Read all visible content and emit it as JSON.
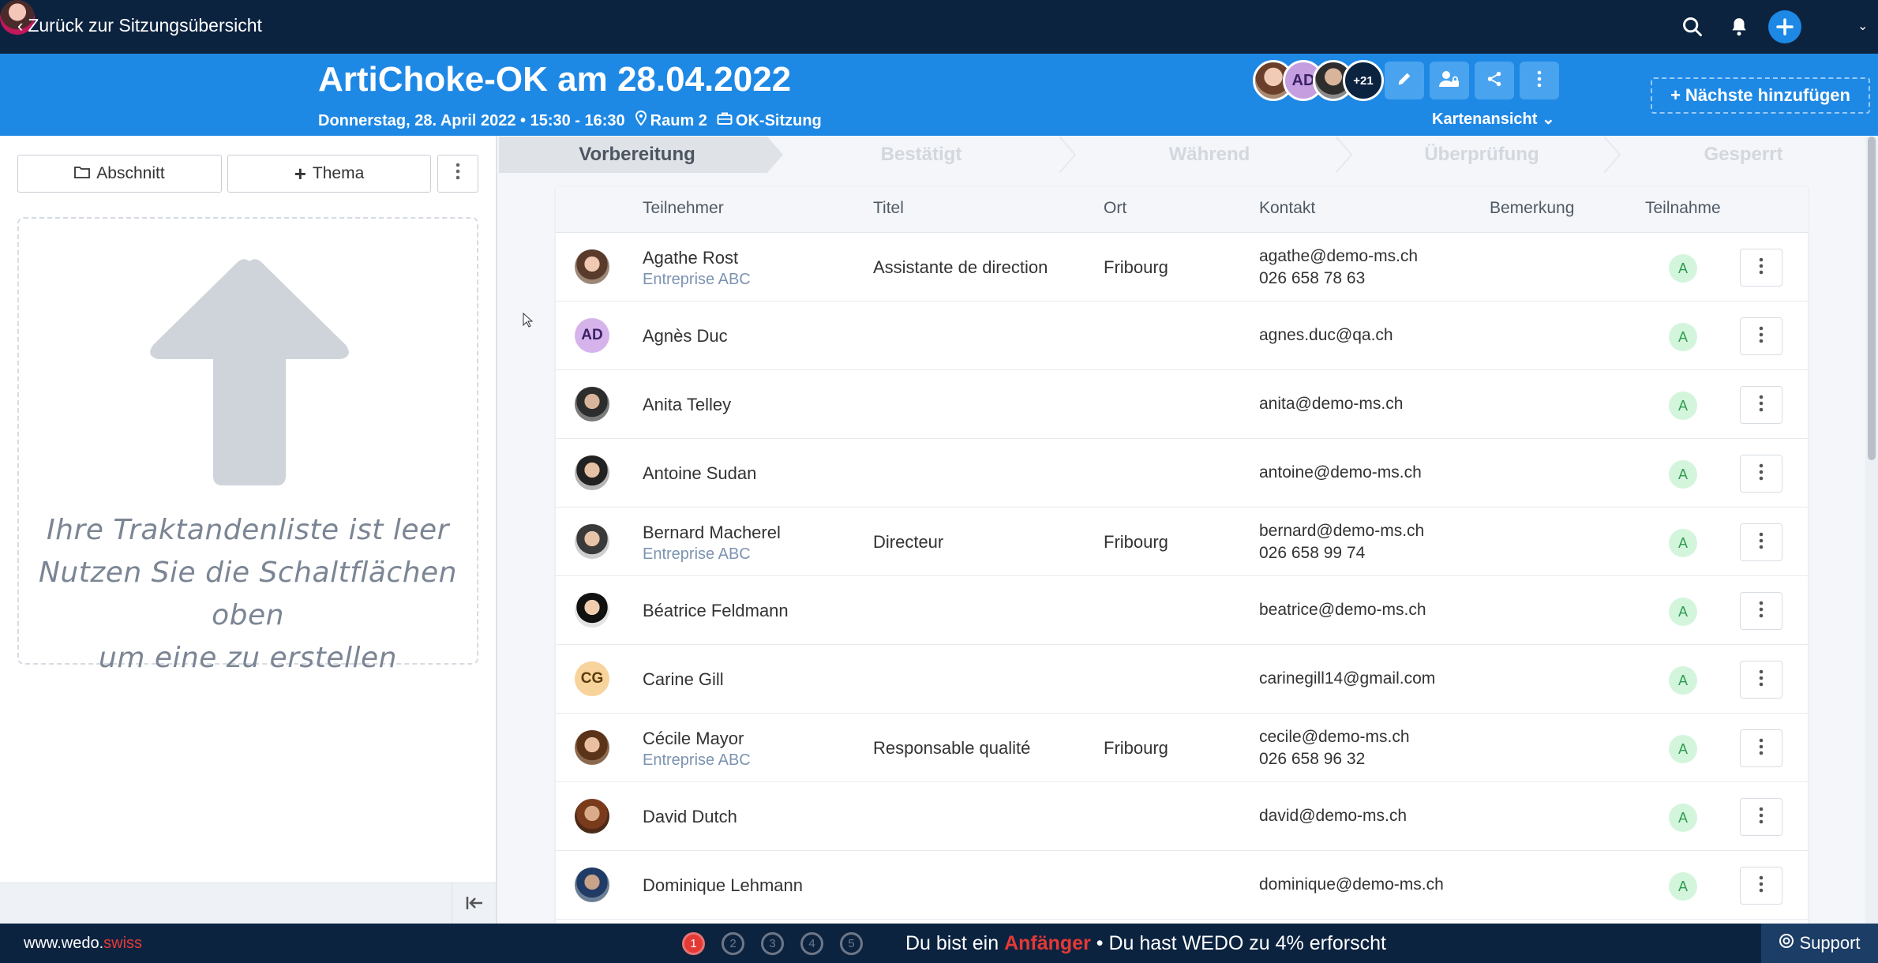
{
  "topbar": {
    "back_label": "Zurück zur Sitzungsübersicht",
    "icons": [
      "search-icon",
      "bell-icon",
      "plus-icon",
      "user-avatar"
    ]
  },
  "meeting": {
    "title": "ArtiChoke-OK am 28.04.2022",
    "datetime": "Donnerstag, 28. April 2022 • 15:30 - 16:30",
    "room": "Raum 2",
    "type": "OK-Sitzung",
    "avatars_more": "+21",
    "avatar_initials": "AD",
    "view_label": "Kartenansicht",
    "add_next_label": "Nächste hinzufügen"
  },
  "left_panel": {
    "section_button": "Abschnitt",
    "topic_button": "Thema",
    "empty_line1": "Ihre Traktandenliste ist leer",
    "empty_line2": "Nutzen Sie die Schaltflächen oben",
    "empty_line3": "um eine zu erstellen"
  },
  "stages": [
    "Vorbereitung",
    "Bestätigt",
    "Während",
    "Überprüfung",
    "Gesperrt"
  ],
  "active_stage": "Vorbereitung",
  "table": {
    "headers": {
      "participant": "Teilnehmer",
      "title": "Titel",
      "location": "Ort",
      "contact": "Kontakt",
      "remark": "Bemerkung",
      "participation": "Teilnahme"
    },
    "rows": [
      {
        "name": "Agathe Rost",
        "company": "Entreprise ABC",
        "title": "Assistante de direction",
        "location": "Fribourg",
        "email": "agathe@demo-ms.ch",
        "phone": "026 658 78 63",
        "status": "A",
        "avatar": "photo",
        "initials": ""
      },
      {
        "name": "Agnès Duc",
        "company": "",
        "title": "",
        "location": "",
        "email": "agnes.duc@qa.ch",
        "phone": "",
        "status": "A",
        "avatar": "initials",
        "initials": "AD"
      },
      {
        "name": "Anita Telley",
        "company": "",
        "title": "",
        "location": "",
        "email": "anita@demo-ms.ch",
        "phone": "",
        "status": "A",
        "avatar": "photo",
        "initials": ""
      },
      {
        "name": "Antoine Sudan",
        "company": "",
        "title": "",
        "location": "",
        "email": "antoine@demo-ms.ch",
        "phone": "",
        "status": "A",
        "avatar": "photo",
        "initials": ""
      },
      {
        "name": "Bernard Macherel",
        "company": "Entreprise ABC",
        "title": "Directeur",
        "location": "Fribourg",
        "email": "bernard@demo-ms.ch",
        "phone": "026 658 99 74",
        "status": "A",
        "avatar": "photo",
        "initials": ""
      },
      {
        "name": "Béatrice Feldmann",
        "company": "",
        "title": "",
        "location": "",
        "email": "beatrice@demo-ms.ch",
        "phone": "",
        "status": "A",
        "avatar": "photo",
        "initials": ""
      },
      {
        "name": "Carine Gill",
        "company": "",
        "title": "",
        "location": "",
        "email": "carinegill14@gmail.com",
        "phone": "",
        "status": "A",
        "avatar": "initials",
        "initials": "CG"
      },
      {
        "name": "Cécile Mayor",
        "company": "Entreprise ABC",
        "title": "Responsable qualité",
        "location": "Fribourg",
        "email": "cecile@demo-ms.ch",
        "phone": "026 658 96 32",
        "status": "A",
        "avatar": "photo",
        "initials": ""
      },
      {
        "name": "David Dutch",
        "company": "",
        "title": "",
        "location": "",
        "email": "david@demo-ms.ch",
        "phone": "",
        "status": "A",
        "avatar": "photo",
        "initials": ""
      },
      {
        "name": "Dominique Lehmann",
        "company": "",
        "title": "",
        "location": "",
        "email": "dominique@demo-ms.ch",
        "phone": "",
        "status": "A",
        "avatar": "photo",
        "initials": ""
      }
    ]
  },
  "footer": {
    "brand_main": "www.wedo.",
    "brand_tld": "swiss",
    "steps": [
      "1",
      "2",
      "3",
      "4",
      "5"
    ],
    "active_step": "1",
    "progress_prefix": "Du bist ein",
    "progress_level": "Anfänger",
    "progress_suffix": "• Du hast WEDO zu 4% erforscht",
    "support_label": "Support"
  },
  "colors": {
    "navy": "#0c2340",
    "blue": "#1e88e5",
    "accent_red": "#e53935",
    "status_green": "#2e9c4f"
  }
}
